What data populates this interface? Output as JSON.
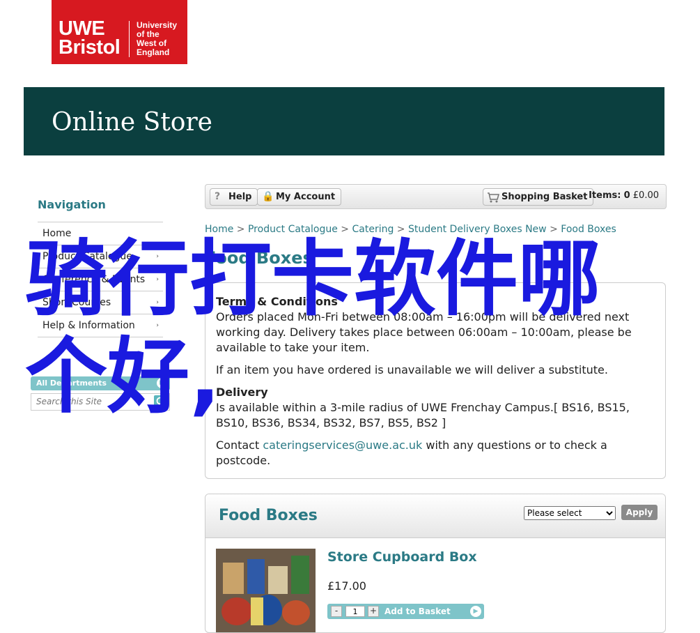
{
  "logo": {
    "wordmark_line1": "UWE",
    "wordmark_line2": "Bristol",
    "tagline_line1": "University",
    "tagline_line2": "of the",
    "tagline_line3": "West of",
    "tagline_line4": "England",
    "color": "#d71920"
  },
  "banner": {
    "title": "Online Store",
    "color": "#0b3f3f"
  },
  "sidebar": {
    "title": "Navigation",
    "items": [
      {
        "label": "Home",
        "arrow": ""
      },
      {
        "label": "Product Catalogue",
        "arrow": "›"
      },
      {
        "label": "Conference & Events",
        "arrow": "›"
      },
      {
        "label": "Short Courses",
        "arrow": "›"
      },
      {
        "label": "Help & Information",
        "arrow": "›"
      }
    ],
    "departments_label": "All Departments",
    "search_placeholder": "Search this Site"
  },
  "toolbar": {
    "help": "Help",
    "account": "My Account",
    "basket": "Shopping Basket",
    "items_label": "Items:",
    "items_count": "0",
    "items_total": "£0.00"
  },
  "breadcrumb": [
    "Home",
    "Product Catalogue",
    "Catering",
    "Student Delivery Boxes New",
    "Food Boxes"
  ],
  "page_title": "Food Boxes",
  "terms": {
    "heading": "Terms & Conditions",
    "text1": "Orders placed Mon-Fri between 08:00am – 16:00pm will be delivered next working day. Delivery takes place between 06:00am – 10:00am, please be available to take your item.",
    "text2": "If an item you have ordered is unavailable we will deliver a substitute.",
    "delivery_heading": "Delivery",
    "delivery_text": "Is available within a 3-mile radius of UWE Frenchay Campus.[ BS16, BS15, BS10, BS36, BS34, BS32, BS7, BS5, BS2 ]",
    "contact_prefix": "Contact ",
    "contact_email": "cateringservices@uwe.ac.uk",
    "contact_suffix": " with any questions or to check a postcode."
  },
  "panel": {
    "title": "Food Boxes",
    "select_value": "Please select",
    "apply": "Apply"
  },
  "product": {
    "name": "Store Cupboard Box",
    "price": "£17.00",
    "qty": "1",
    "minus": "-",
    "plus": "+",
    "add_label": "Add to Basket"
  },
  "overlay_text": "骑行打卡软件哪个好,",
  "colors": {
    "accent": "#2b7a85",
    "light_accent": "#7ec4c9",
    "overlay": "#1a1adf"
  }
}
